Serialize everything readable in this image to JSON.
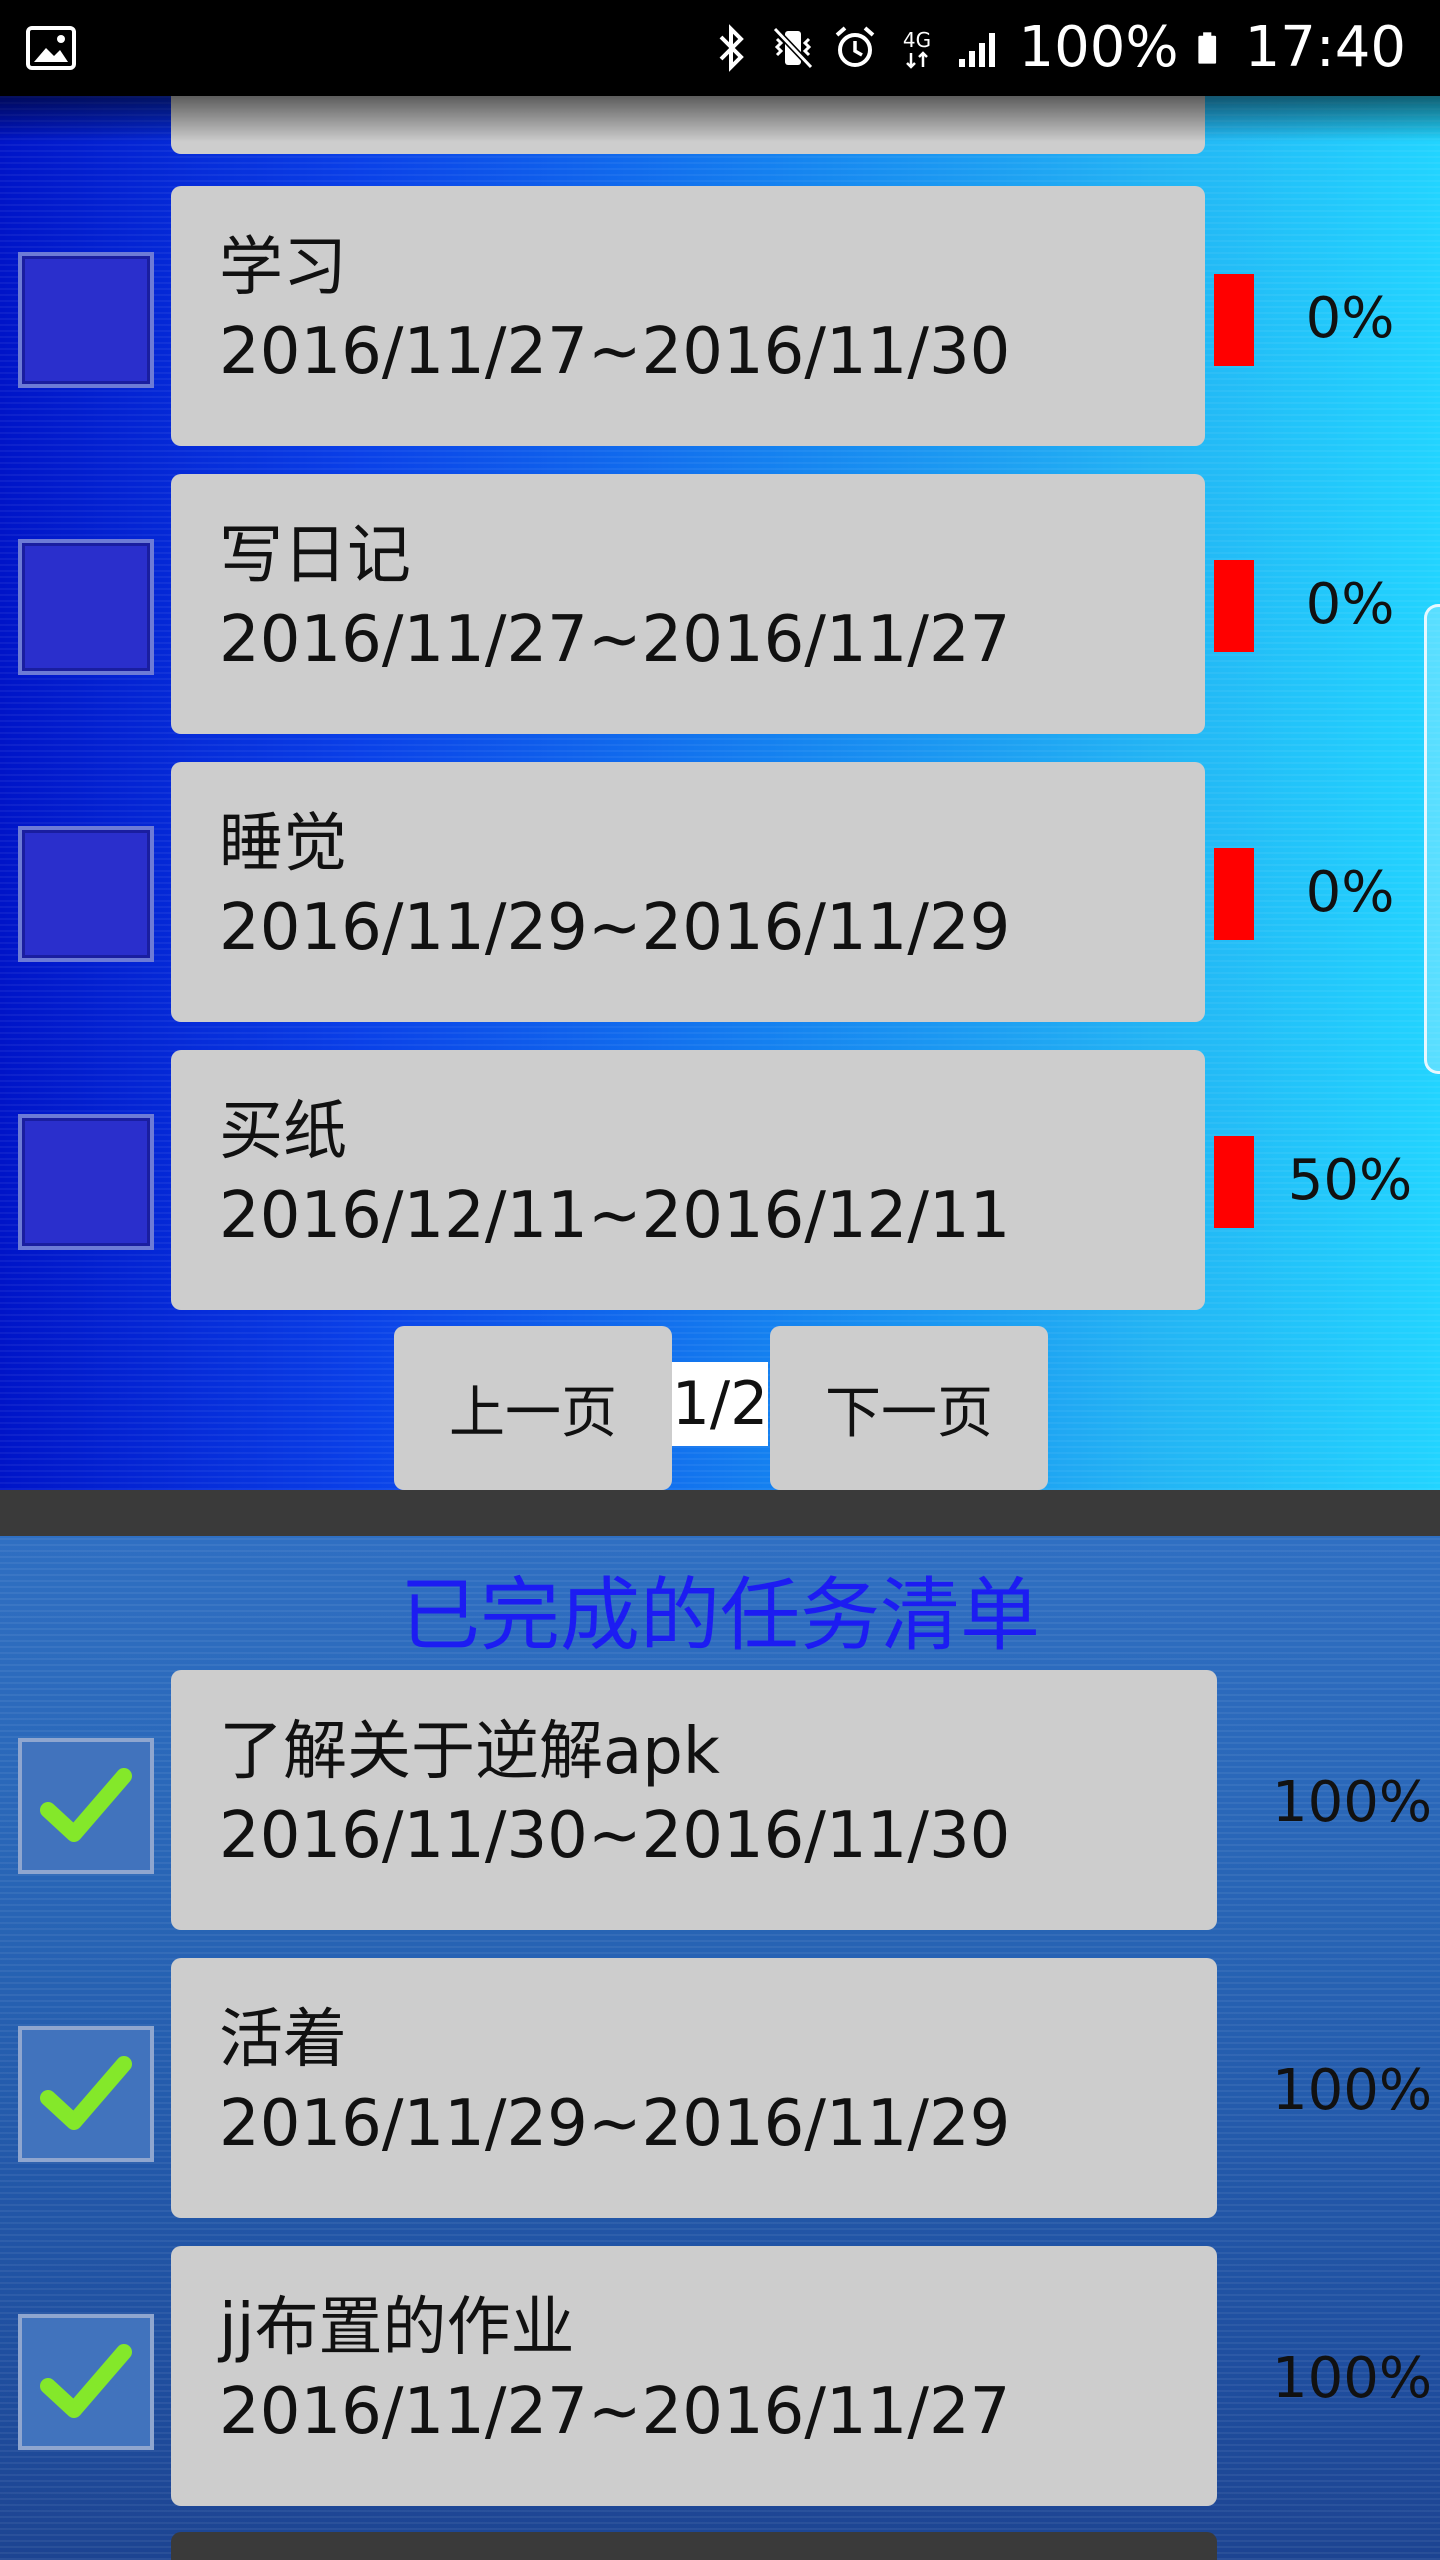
{
  "status_bar": {
    "icons": [
      "image-icon",
      "bluetooth-icon",
      "vibrate-icon",
      "alarm-icon",
      "4g-icon",
      "signal-icon",
      "battery-icon"
    ],
    "network": "4G",
    "battery_percent": "100%",
    "time": "17:40"
  },
  "pending_tasks": [
    {
      "title": "学习",
      "dates": "2016/11/27~2016/11/30",
      "progress": "0%"
    },
    {
      "title": "写日记",
      "dates": "2016/11/27~2016/11/27",
      "progress": "0%"
    },
    {
      "title": "睡觉",
      "dates": "2016/11/29~2016/11/29",
      "progress": "0%"
    },
    {
      "title": "买纸",
      "dates": "2016/12/11~2016/12/11",
      "progress": "50%"
    }
  ],
  "pager": {
    "prev_label": "上一页",
    "next_label": "下一页",
    "page_indicator": "1/2"
  },
  "completed": {
    "heading": "已完成的任务清单",
    "tasks": [
      {
        "title": "了解关于逆解apk",
        "dates": "2016/11/30~2016/11/30",
        "progress": "100%"
      },
      {
        "title": "活着",
        "dates": "2016/11/29~2016/11/29",
        "progress": "100%"
      },
      {
        "title": "jj布置的作业",
        "dates": "2016/11/27~2016/11/27",
        "progress": "100%"
      }
    ]
  },
  "colors": {
    "progress_bar": "#ff0000",
    "card_bg": "#cdcdcd",
    "heading": "#1c1cf2",
    "check": "#84e82a"
  }
}
